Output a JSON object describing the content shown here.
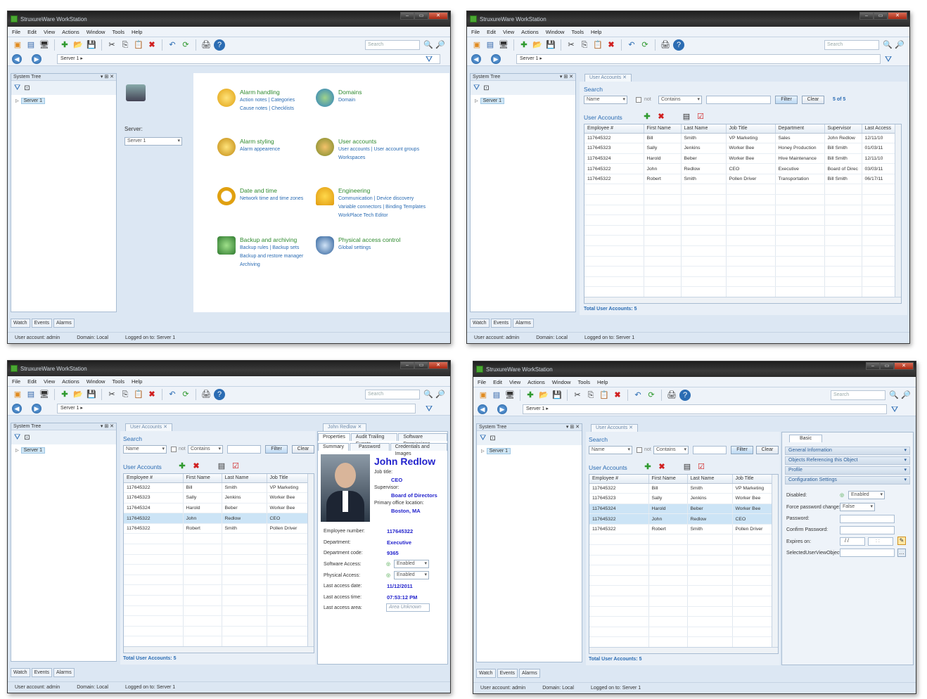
{
  "app": {
    "title": "StruxureWare WorkStation"
  },
  "menu": [
    "File",
    "Edit",
    "View",
    "Actions",
    "Window",
    "Tools",
    "Help"
  ],
  "toolbar": {
    "search_placeholder": "Search"
  },
  "address": {
    "path": "Server 1"
  },
  "tree": {
    "title": "System Tree",
    "root": "Server 1"
  },
  "bottom_tabs": [
    "Watch",
    "Events",
    "Alarms"
  ],
  "status": {
    "user": "User account: admin",
    "domain": "Domain: Local",
    "logon": "Logged on to: Server 1"
  },
  "win1": {
    "server_label": "Server:",
    "server_value": "Server 1",
    "items": [
      {
        "title": "Alarm handling",
        "links": [
          "Action notes",
          "|",
          "Categories"
        ],
        "links2": [
          "Cause notes",
          "|",
          "Checklists"
        ]
      },
      {
        "title": "Domains",
        "links": [
          "Domain"
        ],
        "links2": []
      },
      {
        "title": "Alarm styling",
        "links": [
          "Alarm appearence"
        ],
        "links2": []
      },
      {
        "title": "User accounts",
        "links": [
          "User accounts",
          "|",
          "User account groups"
        ],
        "links2": [
          "Workspaces"
        ]
      },
      {
        "title": "Date and time",
        "links": [
          "Network time and time zones"
        ],
        "links2": []
      },
      {
        "title": "Engineering",
        "links": [
          "Communication",
          "|",
          "Device discovery"
        ],
        "links2": [
          "Variable connectors",
          "|",
          "Binding Templates"
        ],
        "links3": [
          "WorkPlace Tech Editor"
        ]
      },
      {
        "title": "Backup and archiving",
        "links": [
          "Backup rules",
          "|",
          "Backup sets"
        ],
        "links2": [
          "Backup and restore manager"
        ],
        "links3": [
          "Archiving"
        ]
      },
      {
        "title": "Physical access control",
        "links": [
          "Global settings"
        ],
        "links2": []
      }
    ]
  },
  "ua": {
    "tab": "User Accounts",
    "search_title": "Search",
    "field": "Name",
    "not_label": "not",
    "op": "Contains",
    "filter": "Filter",
    "clear": "Clear",
    "count": "5 of 5",
    "list_title": "User Accounts",
    "total": "Total User Accounts: 5",
    "columns": [
      "Employee #",
      "First Name",
      "Last Name",
      "Job Title",
      "Department",
      "Supervisor",
      "Last Access"
    ],
    "rows": [
      [
        "117645322",
        "Bill",
        "Smith",
        "VP Marketing",
        "Sales",
        "John Redlow",
        "12/11/10"
      ],
      [
        "117645323",
        "Sally",
        "Jenkins",
        "Worker Bee",
        "Honey Production",
        "Bill Smith",
        "01/03/11"
      ],
      [
        "117645324",
        "Harold",
        "Beber",
        "Worker Bee",
        "Hive Maintenance",
        "Bill Smith",
        "12/11/10"
      ],
      [
        "117645322",
        "John",
        "Redlow",
        "CEO",
        "Executive",
        "Board of Direc",
        "03/03/11"
      ],
      [
        "117645322",
        "Robert",
        "Smith",
        "Pollen Driver",
        "Transportation",
        "Bill Smith",
        "06/17/11"
      ]
    ]
  },
  "detail": {
    "tab": "John Redlow",
    "tabs_top": [
      "Properties",
      "Audit Trailing Events",
      "Software Permissions"
    ],
    "tabs_bottom": [
      "Summary",
      "Password",
      "Credentials and Images"
    ],
    "name": "John Redlow",
    "job_title_label": "Job title:",
    "job_title": "CEO",
    "supervisor_label": "Supervisor:",
    "supervisor": "Board of Directors",
    "office_label": "Primary office location:",
    "office": "Boston, MA",
    "fields": [
      {
        "label": "Employee number:",
        "value": "117645322"
      },
      {
        "label": "Department:",
        "value": "Executive"
      },
      {
        "label": "Department code:",
        "value": "9365"
      },
      {
        "label": "Software Access:",
        "value": "Enabled"
      },
      {
        "label": "Physical Access:",
        "value": "Enabled"
      },
      {
        "label": "Last access date:",
        "value": "11/12/2011"
      },
      {
        "label": "Last access time:",
        "value": "07:53:12 PM"
      },
      {
        "label": "Last access area:",
        "value": "Area Unknown"
      }
    ]
  },
  "basic": {
    "tab": "Basic",
    "sections": [
      "General Information",
      "Objects Referencing this Object",
      "Profile",
      "Configuration Settings"
    ],
    "disabled_label": "Disabled:",
    "disabled_value": "Enabled",
    "force_label": "Force password change:",
    "force_value": "False",
    "password_label": "Password:",
    "confirm_label": "Confirm Password:",
    "expires_label": "Expires on:",
    "expires_date": "/ /",
    "expires_time": ": :",
    "suvo_label": "SelectedUserViewObject:"
  }
}
